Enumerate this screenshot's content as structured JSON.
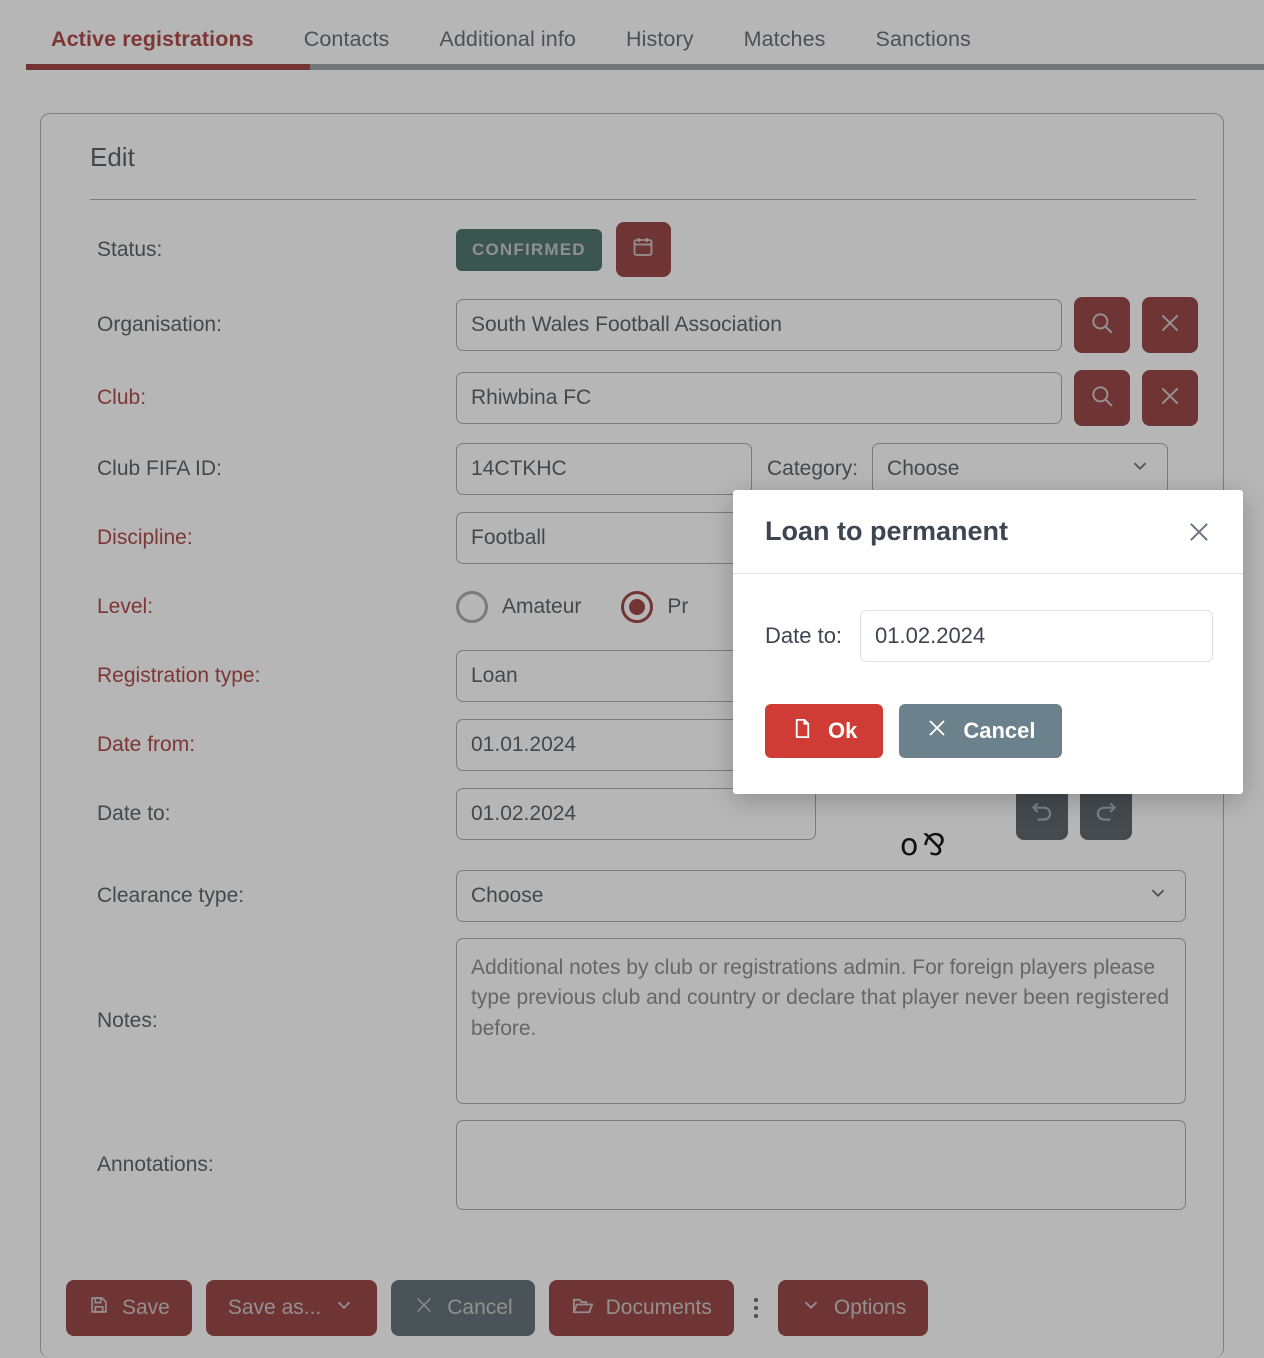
{
  "tabs": [
    {
      "label": "Active registrations",
      "active": true
    },
    {
      "label": "Contacts",
      "active": false
    },
    {
      "label": "Additional info",
      "active": false
    },
    {
      "label": "History",
      "active": false
    },
    {
      "label": "Matches",
      "active": false
    },
    {
      "label": "Sanctions",
      "active": false
    }
  ],
  "card": {
    "title": "Edit"
  },
  "form": {
    "status": {
      "label": "Status:",
      "badge": "CONFIRMED",
      "calendar_icon": "calendar-icon"
    },
    "organisation": {
      "label": "Organisation:",
      "value": "South Wales Football Association",
      "search_icon": "search-icon",
      "clear_icon": "close-icon"
    },
    "club": {
      "label": "Club:",
      "value": "Rhiwbina FC",
      "required": true,
      "search_icon": "search-icon",
      "clear_icon": "close-icon"
    },
    "club_fifa_id": {
      "label": "Club FIFA ID:",
      "value": "14CTKHC"
    },
    "category": {
      "label": "Category:",
      "value": "Choose"
    },
    "discipline": {
      "label": "Discipline:",
      "value": "Football",
      "required": true
    },
    "level": {
      "label": "Level:",
      "required": true,
      "options": [
        {
          "label": "Amateur",
          "selected": false
        },
        {
          "label": "Pr",
          "selected": true
        }
      ]
    },
    "registration_type": {
      "label": "Registration type:",
      "value": "Loan",
      "required": true
    },
    "date_from": {
      "label": "Date from:",
      "value": "01.01.2024",
      "required": true
    },
    "date_to": {
      "label": "Date to:",
      "value": "01.02.2024",
      "undo_icon": "undo-icon",
      "redo_icon": "redo-icon"
    },
    "clearance_type": {
      "label": "Clearance type:",
      "value": "Choose"
    },
    "notes": {
      "label": "Notes:",
      "placeholder": "Additional notes by club or registrations admin. For foreign players please type previous club and country or declare that player never been registered before."
    },
    "annotations": {
      "label": "Annotations:",
      "value": ""
    }
  },
  "footer": {
    "save": {
      "label": "Save",
      "icon": "save-icon"
    },
    "save_as": {
      "label": "Save as...",
      "icon": "chevron-down-icon"
    },
    "cancel": {
      "label": "Cancel",
      "icon": "close-icon"
    },
    "documents": {
      "label": "Documents",
      "icon": "folder-icon"
    },
    "more": {
      "icon": "kebab-menu-icon"
    },
    "options": {
      "label": "Options",
      "icon": "chevron-down-icon"
    }
  },
  "modal": {
    "title": "Loan to permanent",
    "close_icon": "close-icon",
    "date_to_label": "Date to:",
    "date_to_value": "01.02.2024",
    "ok": {
      "label": "Ok",
      "icon": "file-icon"
    },
    "cancel": {
      "label": "Cancel",
      "icon": "close-icon"
    }
  },
  "colors": {
    "brand_red": "#83221f",
    "accent_red": "#9d2423",
    "modal_ok_red": "#cf3b35",
    "slate": "#46555d",
    "confirmed_green": "#2b5a4f"
  }
}
